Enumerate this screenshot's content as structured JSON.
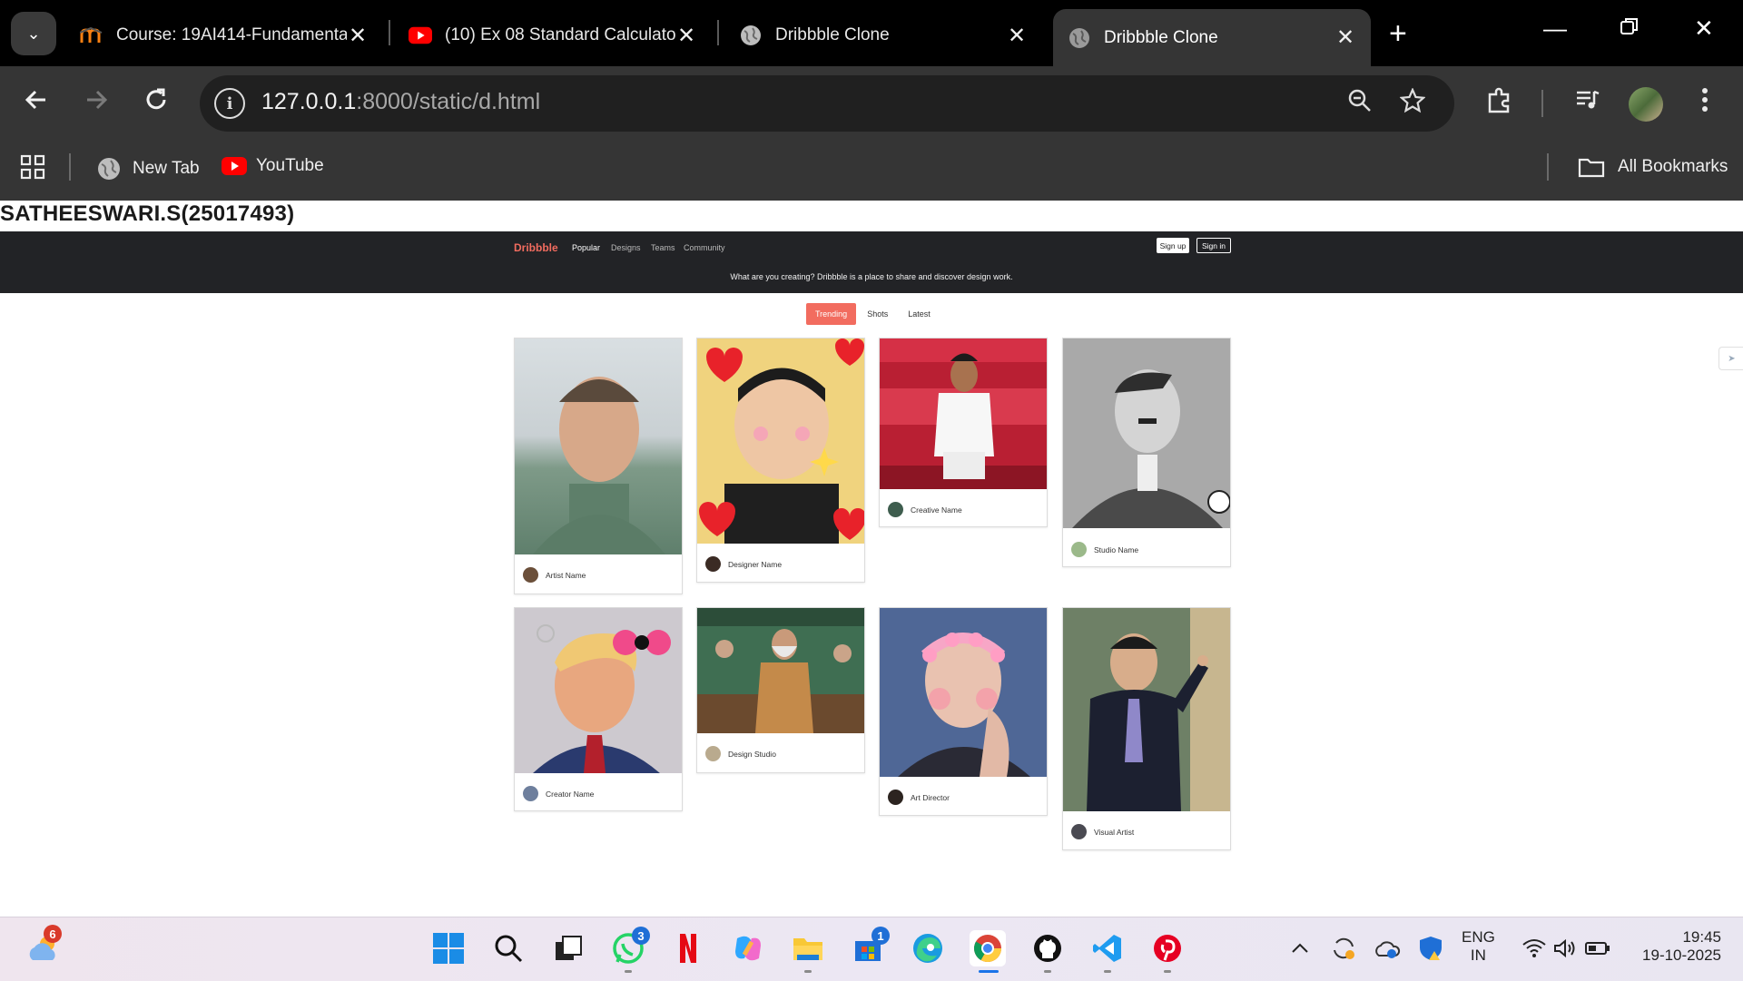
{
  "browser": {
    "tabs": [
      {
        "title": "Course: 19AI414-Fundamenta",
        "icon": "moodle-icon"
      },
      {
        "title": "(10) Ex 08 Standard Calculato",
        "icon": "youtube-icon"
      },
      {
        "title": "Dribbble Clone",
        "icon": "globe-icon"
      },
      {
        "title": "Dribbble Clone",
        "icon": "globe-icon",
        "active": true
      }
    ],
    "url_host": "127.0.0.1",
    "url_path": ":8000/static/d.html",
    "bookmarks": [
      {
        "label": "New Tab",
        "icon": "globe-icon"
      },
      {
        "label": "YouTube",
        "icon": "youtube-icon"
      }
    ],
    "all_bookmarks_label": "All Bookmarks"
  },
  "page": {
    "student_label": "SATHEESWARI.S(25017493)",
    "header": {
      "logo": "Dribbble",
      "nav": [
        "Popular",
        "Designs",
        "Teams",
        "Community"
      ],
      "signup": "Sign up",
      "signin": "Sign in",
      "tagline": "What are you creating? Dribbble is a place to share and discover design work."
    },
    "filters": [
      "Trending",
      "Shots",
      "Latest"
    ],
    "cards": [
      {
        "name": "Artist Name"
      },
      {
        "name": "Designer Name"
      },
      {
        "name": "Creative Name"
      },
      {
        "name": "Studio Name"
      },
      {
        "name": "Creator Name"
      },
      {
        "name": "Design Studio"
      },
      {
        "name": "Art Director"
      },
      {
        "name": "Visual Artist"
      }
    ]
  },
  "taskbar": {
    "weather_badge": "6",
    "whatsapp_badge": "3",
    "store_badge": "1",
    "lang_line1": "ENG",
    "lang_line2": "IN",
    "time": "19:45",
    "date": "19-10-2025"
  }
}
